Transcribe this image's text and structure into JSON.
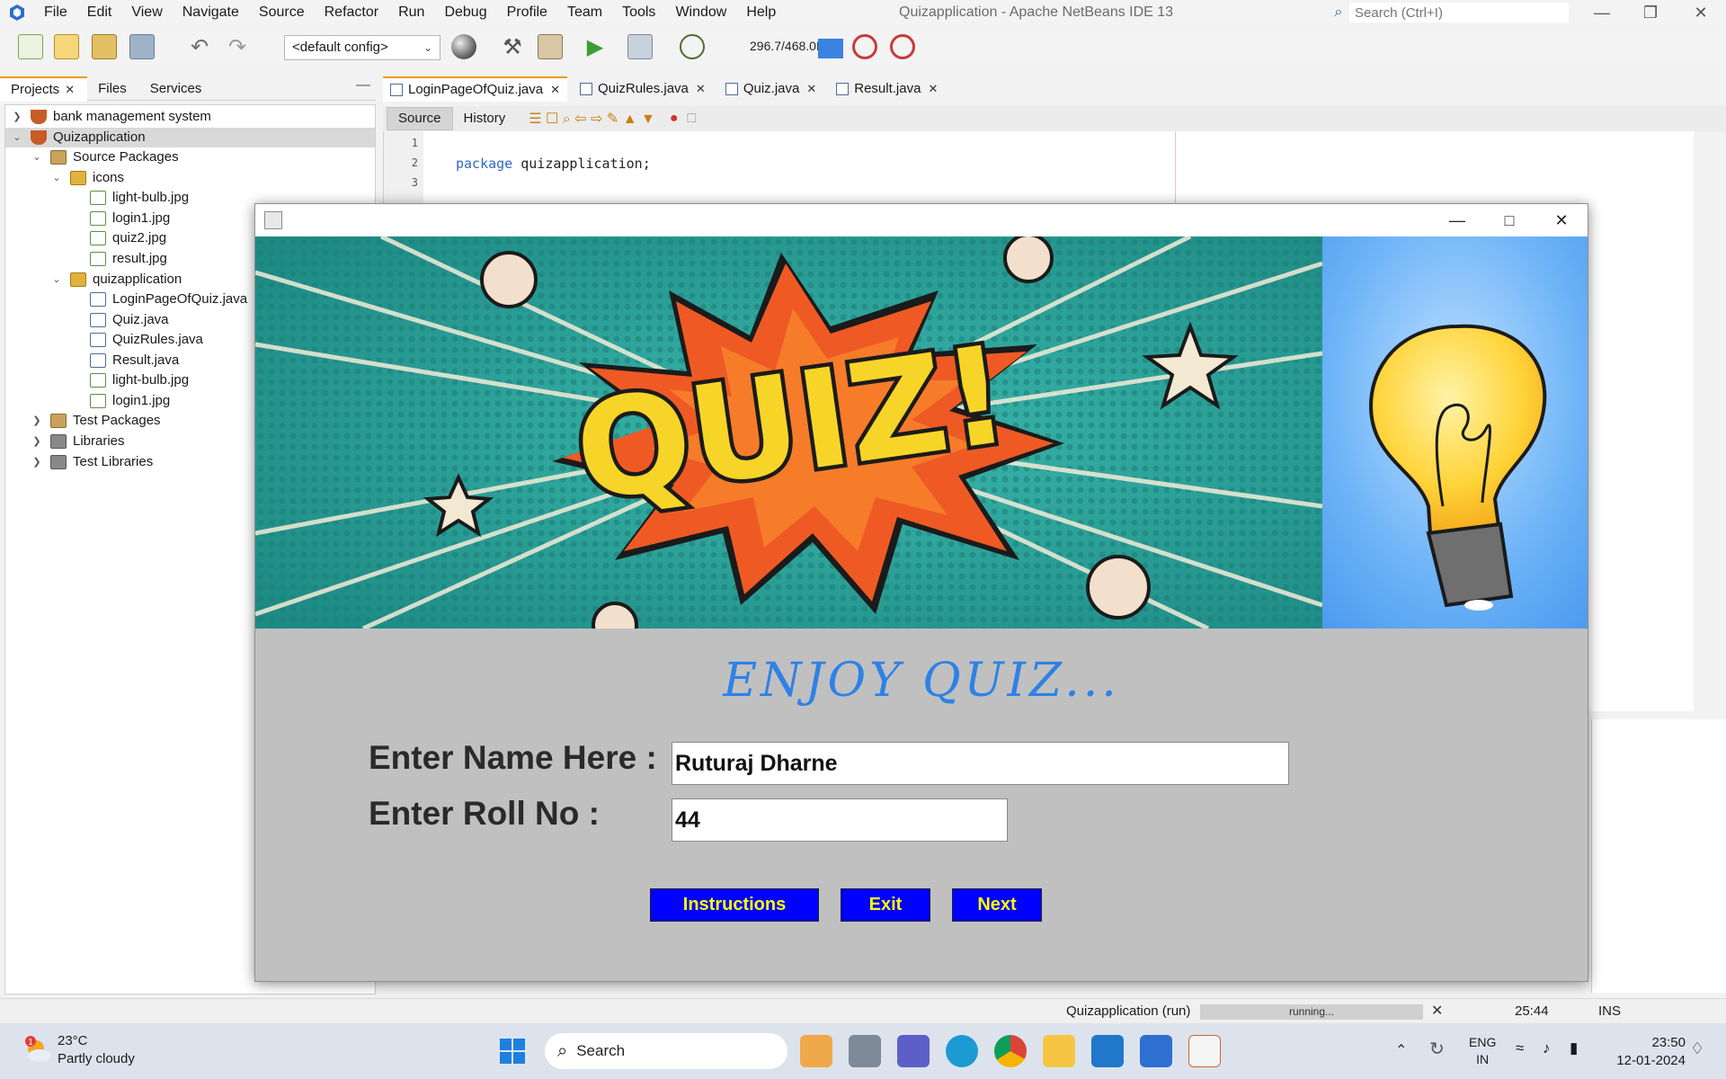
{
  "menubar": {
    "items": [
      "File",
      "Edit",
      "View",
      "Navigate",
      "Source",
      "Refactor",
      "Run",
      "Debug",
      "Profile",
      "Team",
      "Tools",
      "Window",
      "Help"
    ],
    "title": "Quizapplication - Apache NetBeans IDE 13",
    "search_placeholder": "Search (Ctrl+I)"
  },
  "toolbar": {
    "config": "<default config>",
    "memory": "296.7/468.0MB"
  },
  "projects_panel": {
    "tabs": [
      "Projects",
      "Files",
      "Services"
    ],
    "tree": [
      {
        "label": "bank management system",
        "icon": "project-icon",
        "depth": 0,
        "expanded": false
      },
      {
        "label": "Quizapplication",
        "icon": "project-icon",
        "depth": 0,
        "expanded": true,
        "selected": true
      },
      {
        "label": "Source Packages",
        "icon": "source-packages-icon",
        "depth": 1,
        "expanded": true
      },
      {
        "label": "icons",
        "icon": "package-icon",
        "depth": 2,
        "expanded": true
      },
      {
        "label": "light-bulb.jpg",
        "icon": "image-file-icon",
        "depth": 3
      },
      {
        "label": "login1.jpg",
        "icon": "image-file-icon",
        "depth": 3
      },
      {
        "label": "quiz2.jpg",
        "icon": "image-file-icon",
        "depth": 3
      },
      {
        "label": "result.jpg",
        "icon": "image-file-icon",
        "depth": 3
      },
      {
        "label": "quizapplication",
        "icon": "package-icon",
        "depth": 2,
        "expanded": true
      },
      {
        "label": "LoginPageOfQuiz.java",
        "icon": "java-file-icon",
        "depth": 3
      },
      {
        "label": "Quiz.java",
        "icon": "java-file-icon",
        "depth": 3
      },
      {
        "label": "QuizRules.java",
        "icon": "java-file-icon",
        "depth": 3
      },
      {
        "label": "Result.java",
        "icon": "java-file-icon",
        "depth": 3
      },
      {
        "label": "light-bulb.jpg",
        "icon": "image-file-icon",
        "depth": 3
      },
      {
        "label": "login1.jpg",
        "icon": "image-file-icon",
        "depth": 3
      },
      {
        "label": "Test Packages",
        "icon": "test-packages-icon",
        "depth": 1,
        "expanded": false
      },
      {
        "label": "Libraries",
        "icon": "libraries-icon",
        "depth": 1,
        "expanded": false
      },
      {
        "label": "Test Libraries",
        "icon": "test-libraries-icon",
        "depth": 1,
        "expanded": false
      }
    ]
  },
  "editor": {
    "tabs": [
      "LoginPageOfQuiz.java",
      "QuizRules.java",
      "Quiz.java",
      "Result.java"
    ],
    "source_label": "Source",
    "history_label": "History",
    "line_numbers": [
      "1",
      "2",
      "3"
    ],
    "code_keyword": "package",
    "code_rest": "quizapplication;"
  },
  "statusbar": {
    "run_label": "Quizapplication (run)",
    "progress_text": "running...",
    "caret": "25:44",
    "mode": "INS"
  },
  "quiz_window": {
    "banner_text": "QUIZ!",
    "heading": "ENJOY QUIZ...",
    "name_label": "Enter Name Here :",
    "name_value": "Ruturaj Dharne",
    "roll_label": "Enter Roll No :",
    "roll_value": "44",
    "buttons": {
      "instructions": "Instructions",
      "exit": "Exit",
      "next": "Next"
    },
    "colors": {
      "window_bg": "#c0c0c0",
      "heading": "#2e82e6",
      "button_bg": "#0000ff",
      "button_text": "#ffff00",
      "banner_bg": "#2aa39a",
      "bulb_bg": "#5aa6f5"
    }
  },
  "taskbar": {
    "weather_temp": "23°C",
    "weather_desc": "Partly cloudy",
    "weather_badge": "1",
    "search_label": "Search",
    "lang_top": "ENG",
    "lang_bottom": "IN",
    "time": "23:50",
    "date": "12-01-2024"
  }
}
